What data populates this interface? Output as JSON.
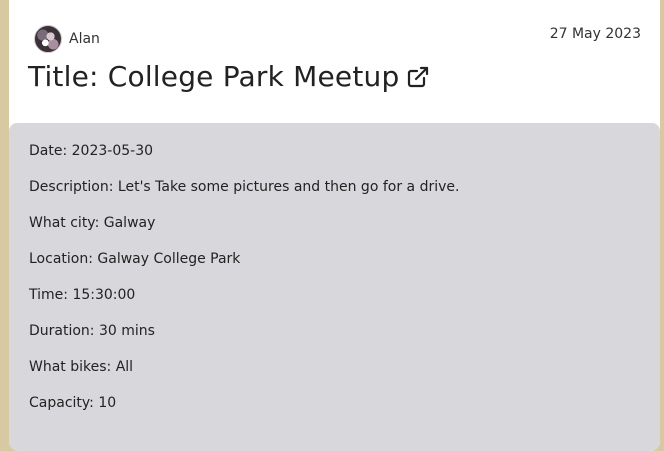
{
  "post": {
    "author": "Alan",
    "date": "27 May 2023",
    "title": "Title: College Park Meetup"
  },
  "icons": {
    "avatar": "avatar-image",
    "external_link": "external-link-icon"
  },
  "details": {
    "date_label": "Date:",
    "date_value": "2023-05-30",
    "description_label": "Description:",
    "description_value": "Let's Take some pictures and then go for a drive.",
    "city_label": "What city:",
    "city_value": "Galway",
    "location_label": "Location:",
    "location_value": "Galway College Park",
    "time_label": "Time:",
    "time_value": "15:30:00",
    "duration_label": "Duration:",
    "duration_value": "30 mins",
    "bikes_label": "What bikes:",
    "bikes_value": "All",
    "capacity_label": "Capacity:",
    "capacity_value": "10"
  }
}
